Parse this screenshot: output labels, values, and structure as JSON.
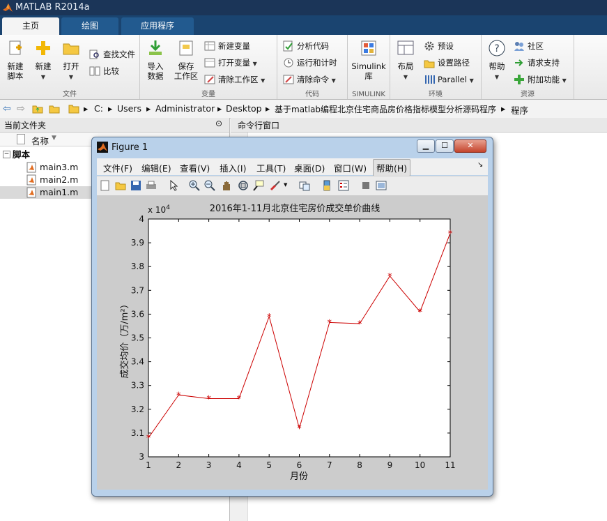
{
  "window": {
    "title": "MATLAB R2014a"
  },
  "ribbon_tabs": [
    "主页",
    "绘图",
    "应用程序"
  ],
  "ribbon": {
    "file": {
      "label": "文件",
      "new_script": "新建\n脚本",
      "new": "新建",
      "open": "打开",
      "find_files": "查找文件",
      "compare": "比较"
    },
    "variable": {
      "label": "变量",
      "import": "导入\n数据",
      "save_ws": "保存\n工作区",
      "new_var": "新建变量",
      "open_var": "打开变量",
      "clear_ws": "清除工作区"
    },
    "code": {
      "label": "代码",
      "analyze": "分析代码",
      "run_time": "运行和计时",
      "clear_cmd": "清除命令"
    },
    "simulink": {
      "label": "SIMULINK",
      "lib": "Simulink\n库"
    },
    "env": {
      "label": "环境",
      "layout": "布局",
      "prefs": "预设",
      "set_path": "设置路径",
      "parallel": "Parallel"
    },
    "resources": {
      "label": "资源",
      "help": "帮助",
      "community": "社区",
      "request_support": "请求支持",
      "addons": "附加功能"
    }
  },
  "address": {
    "crumbs": [
      "C:",
      "Users",
      "Administrator",
      "Desktop",
      "基于matlab编程北京住宅商品房价格指标模型分析源码程序",
      "程序"
    ]
  },
  "current_folder": {
    "title": "当前文件夹",
    "col_name": "名称",
    "group": "脚本",
    "files": [
      "main3.m",
      "main2.m",
      "main1.m"
    ]
  },
  "command_window": {
    "title": "命令行窗口"
  },
  "figure": {
    "title": "Figure 1",
    "menu": [
      "文件(F)",
      "编辑(E)",
      "查看(V)",
      "插入(I)",
      "工具(T)",
      "桌面(D)",
      "窗口(W)",
      "帮助(H)"
    ]
  },
  "chart_data": {
    "type": "line",
    "title": "2016年1-11月北京住宅房价成交单价曲线",
    "xlabel": "月份",
    "ylabel": "成交均价（万/m²）",
    "y_exponent": "x 10^4",
    "x": [
      1,
      2,
      3,
      4,
      5,
      6,
      7,
      8,
      9,
      10,
      11
    ],
    "series": [
      {
        "values": [
          3.08,
          3.26,
          3.245,
          3.245,
          3.59,
          3.12,
          3.565,
          3.56,
          3.76,
          3.61,
          3.94
        ],
        "color": "#cc0000",
        "marker": "*"
      }
    ],
    "xlim": [
      1,
      11
    ],
    "ylim": [
      3,
      4
    ],
    "xticks": [
      "1",
      "2",
      "3",
      "4",
      "5",
      "6",
      "7",
      "8",
      "9",
      "10",
      "11"
    ],
    "yticks": [
      "3",
      "3.1",
      "3.2",
      "3.3",
      "3.4",
      "3.5",
      "3.6",
      "3.7",
      "3.8",
      "3.9",
      "4"
    ],
    "grid": true,
    "grid_style": "dashed"
  }
}
